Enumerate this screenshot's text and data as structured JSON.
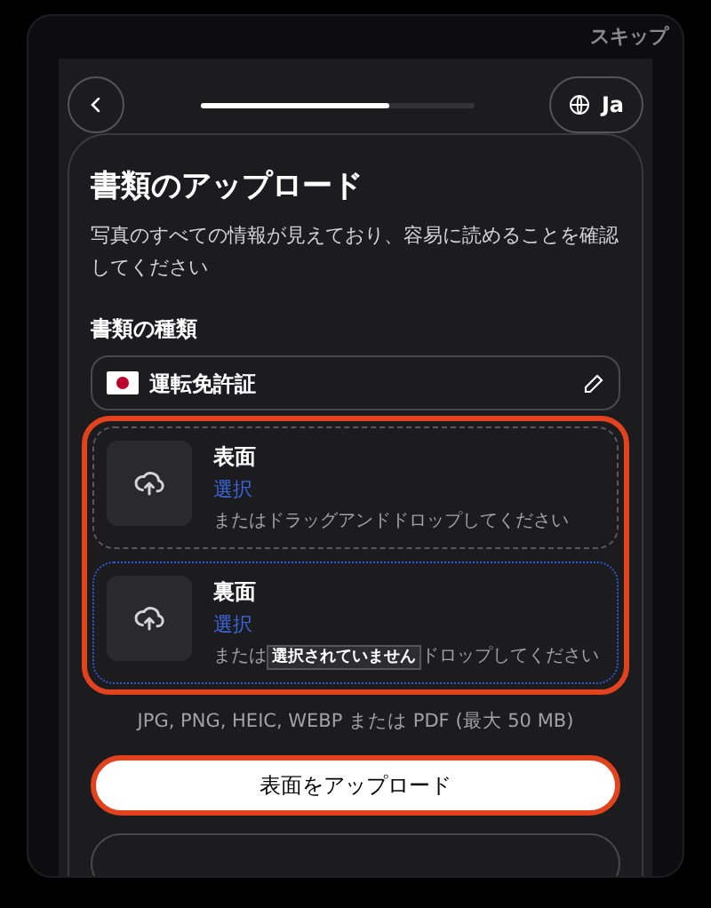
{
  "skip": "スキップ",
  "progress": {
    "level": 0.69
  },
  "language": "Ja",
  "title": "書類のアップロード",
  "description": "写真のすべての情報が見えており、容易に読めることを確認してください",
  "document_type": {
    "label": "書類の種類",
    "value": "運転免許証"
  },
  "slots": [
    {
      "title": "表面",
      "link": "選択",
      "hint_before": "またはドラッグアンドドロップしてください",
      "focused": false
    },
    {
      "title": "裏面",
      "link": "選択",
      "hint_before": "または",
      "tooltip": "選択されていません",
      "hint_after": "ドロップしてください",
      "focused": true
    }
  ],
  "formats": "JPG, PNG, HEIC, WEBP または PDF (最大 50 MB)",
  "upload_button": "表面をアップロード"
}
